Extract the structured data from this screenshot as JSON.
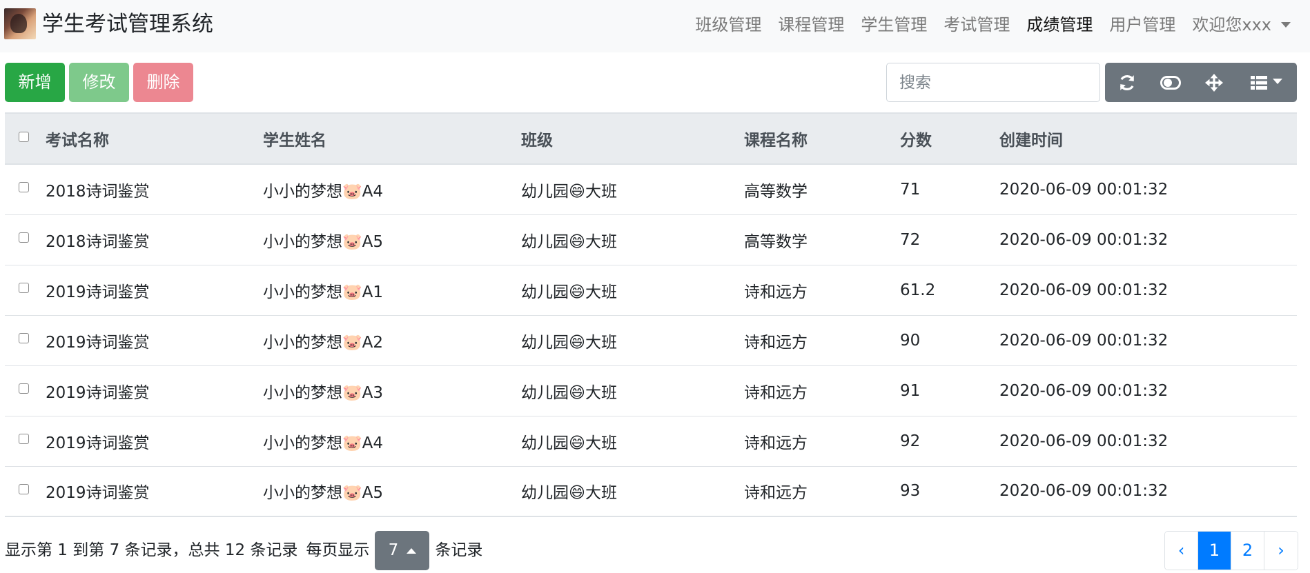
{
  "navbar": {
    "brand": "学生考试管理系统",
    "items": [
      {
        "label": "班级管理",
        "active": false
      },
      {
        "label": "课程管理",
        "active": false
      },
      {
        "label": "学生管理",
        "active": false
      },
      {
        "label": "考试管理",
        "active": false
      },
      {
        "label": "成绩管理",
        "active": true
      },
      {
        "label": "用户管理",
        "active": false
      }
    ],
    "user_menu": "欢迎您xxx"
  },
  "toolbar": {
    "add_label": "新增",
    "edit_label": "修改",
    "delete_label": "删除",
    "search_placeholder": "搜索",
    "icons": [
      "refresh-icon",
      "toggle-icon",
      "move-icon",
      "columns-icon"
    ]
  },
  "table": {
    "columns": [
      "考试名称",
      "学生姓名",
      "班级",
      "课程名称",
      "分数",
      "创建时间"
    ],
    "rows": [
      {
        "exam": "2018诗词鉴赏",
        "student": "小小的梦想🐷A4",
        "class": "幼儿园😄大班",
        "course": "高等数学",
        "score": "71",
        "created": "2020-06-09 00:01:32"
      },
      {
        "exam": "2018诗词鉴赏",
        "student": "小小的梦想🐷A5",
        "class": "幼儿园😄大班",
        "course": "高等数学",
        "score": "72",
        "created": "2020-06-09 00:01:32"
      },
      {
        "exam": "2019诗词鉴赏",
        "student": "小小的梦想🐷A1",
        "class": "幼儿园😄大班",
        "course": "诗和远方",
        "score": "61.2",
        "created": "2020-06-09 00:01:32"
      },
      {
        "exam": "2019诗词鉴赏",
        "student": "小小的梦想🐷A2",
        "class": "幼儿园😄大班",
        "course": "诗和远方",
        "score": "90",
        "created": "2020-06-09 00:01:32"
      },
      {
        "exam": "2019诗词鉴赏",
        "student": "小小的梦想🐷A3",
        "class": "幼儿园😄大班",
        "course": "诗和远方",
        "score": "91",
        "created": "2020-06-09 00:01:32"
      },
      {
        "exam": "2019诗词鉴赏",
        "student": "小小的梦想🐷A4",
        "class": "幼儿园😄大班",
        "course": "诗和远方",
        "score": "92",
        "created": "2020-06-09 00:01:32"
      },
      {
        "exam": "2019诗词鉴赏",
        "student": "小小的梦想🐷A5",
        "class": "幼儿园😄大班",
        "course": "诗和远方",
        "score": "93",
        "created": "2020-06-09 00:01:32"
      }
    ]
  },
  "footer": {
    "info": "显示第 1 到第 7 条记录，总共 12 条记录",
    "per_page_prefix": "每页显示",
    "page_size": "7",
    "per_page_suffix": "条记录"
  },
  "pagination": {
    "prev": "‹",
    "pages": [
      "1",
      "2"
    ],
    "current": "1",
    "next": "›"
  },
  "colors": {
    "success": "#28a745",
    "secondary": "#6c757d",
    "primary": "#007bff",
    "danger_light": "#ec8791"
  }
}
